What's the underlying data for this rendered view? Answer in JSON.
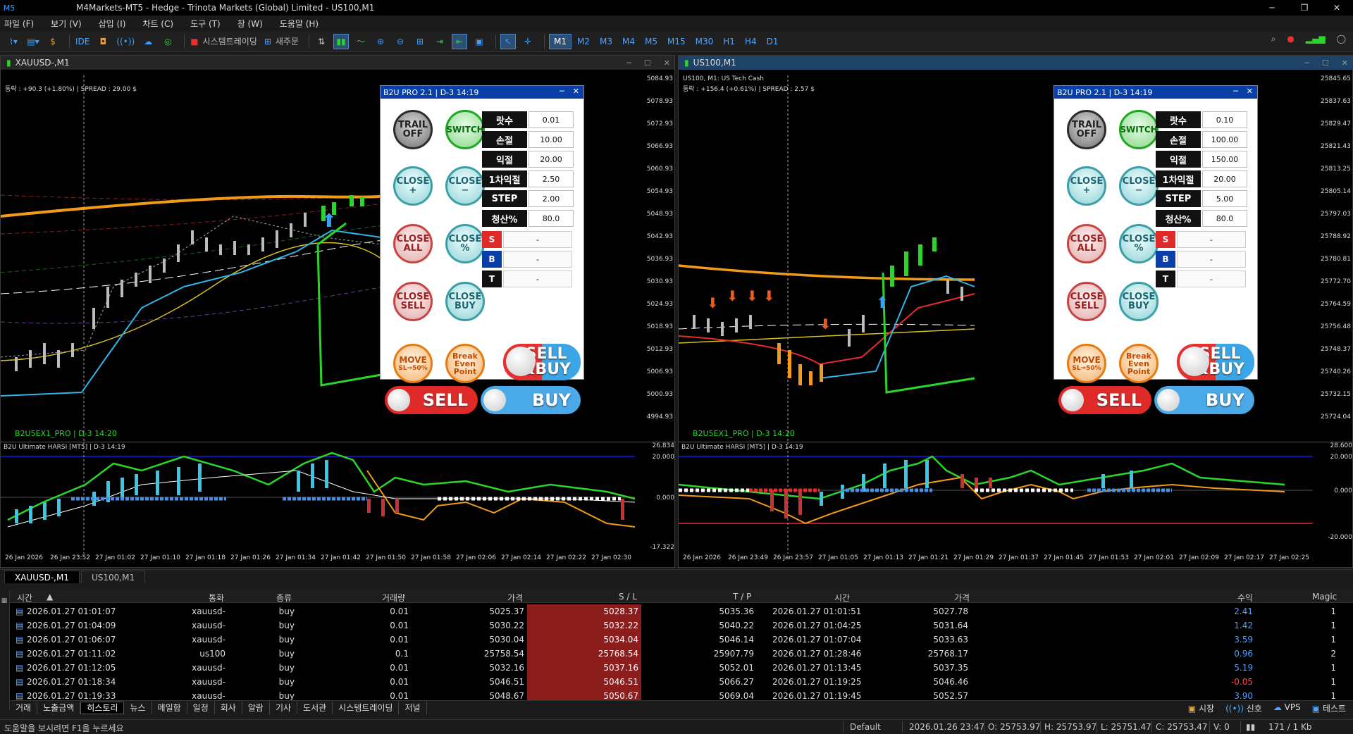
{
  "window": {
    "title": "M4Markets-MT5 - Hedge - Trinota Markets (Global) Limited - US100,M1"
  },
  "menu": [
    "파일 (F)",
    "보기 (V)",
    "삽입 (I)",
    "차트 (C)",
    "도구 (T)",
    "창 (W)",
    "도움말 (H)"
  ],
  "toolbar": {
    "ide": "IDE",
    "algo": "시스템트레이딩",
    "new_order": "새주문",
    "timeframes": [
      "M1",
      "M2",
      "M3",
      "M4",
      "M5",
      "M15",
      "M30",
      "H1",
      "H4",
      "D1"
    ],
    "active_timeframe": "M1"
  },
  "charts": [
    {
      "title": "XAUUSD-,M1",
      "info": "동락 : +90.3 (+1.80%) | SPREAD : 29.00 $",
      "ea_label": "B2U5EX1_PRO | D-3 14:20",
      "prices": [
        "5084.93",
        "5078.93",
        "5072.93",
        "5066.93",
        "5060.93",
        "5054.93",
        "5048.93",
        "5042.93",
        "5036.93",
        "5030.93",
        "5024.93",
        "5018.93",
        "5012.93",
        "5006.93",
        "5000.93",
        "4994.93"
      ],
      "sub_title": "B2U Ultimate HARSI [MT5] | D-3 14:19",
      "sub_levels": [
        "26.834",
        "20.000",
        "0.000",
        "-17.322"
      ],
      "times": [
        "26 Jan 2026",
        "26 Jan 23:52",
        "27 Jan 01:02",
        "27 Jan 01:10",
        "27 Jan 01:18",
        "27 Jan 01:26",
        "27 Jan 01:34",
        "27 Jan 01:42",
        "27 Jan 01:50",
        "27 Jan 01:58",
        "27 Jan 02:06",
        "27 Jan 02:14",
        "27 Jan 02:22",
        "27 Jan 02:30"
      ],
      "panel": {
        "title": "B2U PRO 2.1 | D-3 14:19",
        "fields": [
          [
            "랏수",
            "0.01"
          ],
          [
            "손절",
            "10.00"
          ],
          [
            "익절",
            "20.00"
          ],
          [
            "1차익절",
            "2.50"
          ],
          [
            "STEP",
            "2.00"
          ],
          [
            "청산%",
            "80.0"
          ]
        ],
        "status": [
          [
            "S",
            "-"
          ],
          [
            "B",
            "-"
          ],
          [
            "T",
            "-"
          ]
        ]
      }
    },
    {
      "title": "US100,M1",
      "info_line1": "US100, M1: US Tech Cash",
      "info": "동락 : +156.4 (+0.61%) | SPREAD : 2.57 $",
      "ea_label": "B2U5EX1_PRO | D-3 14:20",
      "prices": [
        "25845.65",
        "25837.63",
        "25829.47",
        "25821.43",
        "25813.25",
        "25805.14",
        "25797.03",
        "25788.92",
        "25780.81",
        "25772.70",
        "25764.59",
        "25756.48",
        "25748.37",
        "25740.26",
        "25732.15",
        "25724.04"
      ],
      "sub_title": "B2U Ultimate HARSI [MT5] | D-3 14:19",
      "sub_levels": [
        "28.600",
        "20.000",
        "0.000",
        "-20.000"
      ],
      "times": [
        "26 Jan 2026",
        "26 Jan 23:49",
        "26 Jan 23:57",
        "27 Jan 01:05",
        "27 Jan 01:13",
        "27 Jan 01:21",
        "27 Jan 01:29",
        "27 Jan 01:37",
        "27 Jan 01:45",
        "27 Jan 01:53",
        "27 Jan 02:01",
        "27 Jan 02:09",
        "27 Jan 02:17",
        "27 Jan 02:25"
      ],
      "panel": {
        "title": "B2U PRO 2.1 | D-3 14:19",
        "fields": [
          [
            "랏수",
            "0.10"
          ],
          [
            "손절",
            "100.00"
          ],
          [
            "익절",
            "150.00"
          ],
          [
            "1차익절",
            "20.00"
          ],
          [
            "STEP",
            "5.00"
          ],
          [
            "청산%",
            "80.0"
          ]
        ],
        "status": [
          [
            "S",
            "-"
          ],
          [
            "B",
            "-"
          ],
          [
            "T",
            "-"
          ]
        ]
      }
    }
  ],
  "buttons": {
    "trail": [
      "TRAIL",
      "OFF"
    ],
    "switch": "SWITCH",
    "close_plus": [
      "CLOSE",
      "+"
    ],
    "close_minus": [
      "CLOSE",
      "−"
    ],
    "close_all": [
      "CLOSE",
      "ALL"
    ],
    "close_pct": [
      "CLOSE",
      "%"
    ],
    "close_sell": [
      "CLOSE",
      "SELL"
    ],
    "close_buy": [
      "CLOSE",
      "BUY"
    ],
    "move": [
      "MOVE",
      "SL→50%"
    ],
    "breakeven": [
      "Break",
      "Even",
      "Point"
    ],
    "sellbuy": [
      "SELL",
      "&BUY"
    ],
    "sell": "SELL",
    "buy": "BUY"
  },
  "chart_tabs": [
    "XAUUSD-,M1",
    "US100,M1"
  ],
  "history": {
    "headers": [
      "시간",
      "통화",
      "종류",
      "거래량",
      "가격",
      "S / L",
      "T / P",
      "시간",
      "가격",
      "수익",
      "Magic"
    ],
    "rows": [
      [
        "2026.01.27 01:01:07",
        "xauusd-",
        "buy",
        "0.01",
        "5025.37",
        "5028.37",
        "5035.36",
        "2026.01.27 01:01:51",
        "5027.78",
        "2.41",
        "1"
      ],
      [
        "2026.01.27 01:04:09",
        "xauusd-",
        "buy",
        "0.01",
        "5030.22",
        "5032.22",
        "5040.22",
        "2026.01.27 01:04:25",
        "5031.64",
        "1.42",
        "1"
      ],
      [
        "2026.01.27 01:06:07",
        "xauusd-",
        "buy",
        "0.01",
        "5030.04",
        "5034.04",
        "5046.14",
        "2026.01.27 01:07:04",
        "5033.63",
        "3.59",
        "1"
      ],
      [
        "2026.01.27 01:11:02",
        "us100",
        "buy",
        "0.1",
        "25758.54",
        "25768.54",
        "25907.79",
        "2026.01.27 01:28:46",
        "25768.17",
        "0.96",
        "2"
      ],
      [
        "2026.01.27 01:12:05",
        "xauusd-",
        "buy",
        "0.01",
        "5032.16",
        "5037.16",
        "5052.01",
        "2026.01.27 01:13:45",
        "5037.35",
        "5.19",
        "1"
      ],
      [
        "2026.01.27 01:18:34",
        "xauusd-",
        "buy",
        "0.01",
        "5046.51",
        "5046.51",
        "5066.27",
        "2026.01.27 01:19:25",
        "5046.46",
        "-0.05",
        "1"
      ],
      [
        "2026.01.27 01:19:33",
        "xauusd-",
        "buy",
        "0.01",
        "5048.67",
        "5050.67",
        "5069.04",
        "2026.01.27 01:19:45",
        "5052.57",
        "3.90",
        "1"
      ]
    ]
  },
  "bottom_tabs": [
    "거래",
    "노출금액",
    "히스토리",
    "뉴스",
    "메일함",
    "일정",
    "회사",
    "알람",
    "기사",
    "도서관",
    "시스템트레이딩",
    "저널"
  ],
  "bottom_active": "히스토리",
  "bottom_right": [
    "시장",
    "신호",
    "VPS",
    "테스트"
  ],
  "status": {
    "help": "도움말을 보시려면 F1을 누르세요",
    "profile": "Default",
    "datetime": "2026.01.26 23:47",
    "open": "O: 25753.97",
    "high": "H: 25753.97",
    "low": "L: 25751.47",
    "close": "C: 25753.47",
    "volume": "V: 0",
    "traffic": "171 / 1 Kb"
  }
}
